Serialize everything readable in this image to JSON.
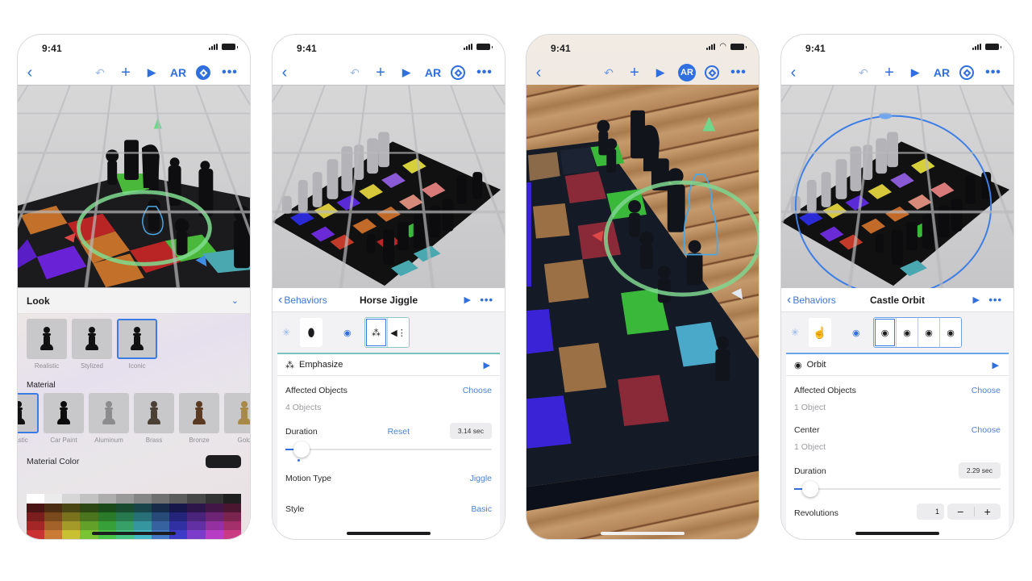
{
  "status_bar": {
    "time": "9:41"
  },
  "toolbar": {
    "back_icon": "‹",
    "undo_icon": "↶",
    "add_icon": "+",
    "play_icon": "▶",
    "ar_label": "AR",
    "more_icon": "•••"
  },
  "screens": [
    {
      "id": "look",
      "ar_active": false,
      "settings_active": true,
      "look_panel": {
        "title": "Look",
        "collapse_icon": "chevron-down",
        "looks": [
          {
            "label": "Realistic",
            "selected": false
          },
          {
            "label": "Stylized",
            "selected": false
          },
          {
            "label": "Iconic",
            "selected": true
          }
        ],
        "material_label": "Material",
        "materials": [
          {
            "label": "Plastic",
            "selected": true,
            "color": "#111111"
          },
          {
            "label": "Car Paint",
            "selected": false,
            "color": "#0b0b0b"
          },
          {
            "label": "Aluminum",
            "selected": false,
            "color": "#8c8c8e"
          },
          {
            "label": "Brass",
            "selected": false,
            "color": "#4a4036"
          },
          {
            "label": "Bronze",
            "selected": false,
            "color": "#5a3a22"
          },
          {
            "label": "Gold",
            "selected": false,
            "color": "#a88a48"
          }
        ],
        "material_color_label": "Material Color",
        "material_color_value": "#1d1d1f",
        "palette": [
          [
            "#ffffff",
            "#ebebeb",
            "#d6d6d6",
            "#c2c2c2",
            "#adadad",
            "#999999",
            "#858585",
            "#707070",
            "#5c5c5c",
            "#474747",
            "#333333",
            "#1f1f1f"
          ],
          [
            "#4a1414",
            "#4a2d12",
            "#4a4614",
            "#2d4714",
            "#1a4a1a",
            "#184a30",
            "#18444a",
            "#182c4a",
            "#16164a",
            "#2d164a",
            "#421646",
            "#4a1630"
          ],
          [
            "#7a1d1d",
            "#7a4a1d",
            "#7a721d",
            "#4a741d",
            "#2a7a2a",
            "#28784e",
            "#287078",
            "#284a78",
            "#24247a",
            "#4a247a",
            "#6e2474",
            "#7a2450"
          ],
          [
            "#a32727",
            "#a3622a",
            "#a39a2a",
            "#62a02a",
            "#38a038",
            "#36a068",
            "#36969f",
            "#3662a0",
            "#3030a3",
            "#6230a3",
            "#9430a0",
            "#a3306a"
          ],
          [
            "#c93232",
            "#c97a34",
            "#c9c034",
            "#7ac434",
            "#46c446",
            "#44c480",
            "#44b8c4",
            "#447ac4",
            "#3c3cc9",
            "#7a3cc9",
            "#b83cc4",
            "#c93c84"
          ]
        ]
      }
    },
    {
      "id": "horse-jiggle",
      "ar_active": false,
      "settings_active": false,
      "behavior": {
        "back_label": "Behaviors",
        "title": "Horse Jiggle",
        "trigger_icon": "tap-object",
        "actions": [
          "emphasize",
          "play-sound"
        ],
        "selected_action": {
          "icon": "emphasize",
          "name": "Emphasize",
          "affected_objects_label": "Affected Objects",
          "affected_objects_action": "Choose",
          "affected_objects_value": "4 Objects",
          "duration_label": "Duration",
          "duration_reset": "Reset",
          "duration_value": "3.14 sec",
          "duration_fraction": 0.08,
          "motion_type_label": "Motion Type",
          "motion_type_value": "Jiggle",
          "style_label": "Style",
          "style_value": "Basic"
        }
      }
    },
    {
      "id": "ar-view",
      "ar_active": true,
      "settings_active": false
    },
    {
      "id": "castle-orbit",
      "ar_active": false,
      "settings_active": false,
      "behavior": {
        "back_label": "Behaviors",
        "title": "Castle Orbit",
        "trigger_icon": "tap",
        "actions": [
          "orbit",
          "orbit",
          "orbit",
          "orbit"
        ],
        "selected_action": {
          "icon": "orbit",
          "name": "Orbit",
          "affected_objects_label": "Affected Objects",
          "affected_objects_action": "Choose",
          "affected_objects_value": "1 Object",
          "center_label": "Center",
          "center_action": "Choose",
          "center_value": "1 Object",
          "duration_label": "Duration",
          "duration_value": "2.29 sec",
          "duration_fraction": 0.08,
          "revolutions_label": "Revolutions",
          "revolutions_value": "1",
          "decrement": "−",
          "increment": "+"
        }
      }
    }
  ],
  "colors": {
    "accent": "#2f6fe0",
    "link": "#4a82d6",
    "teal_outline": "#8cc7c7"
  }
}
